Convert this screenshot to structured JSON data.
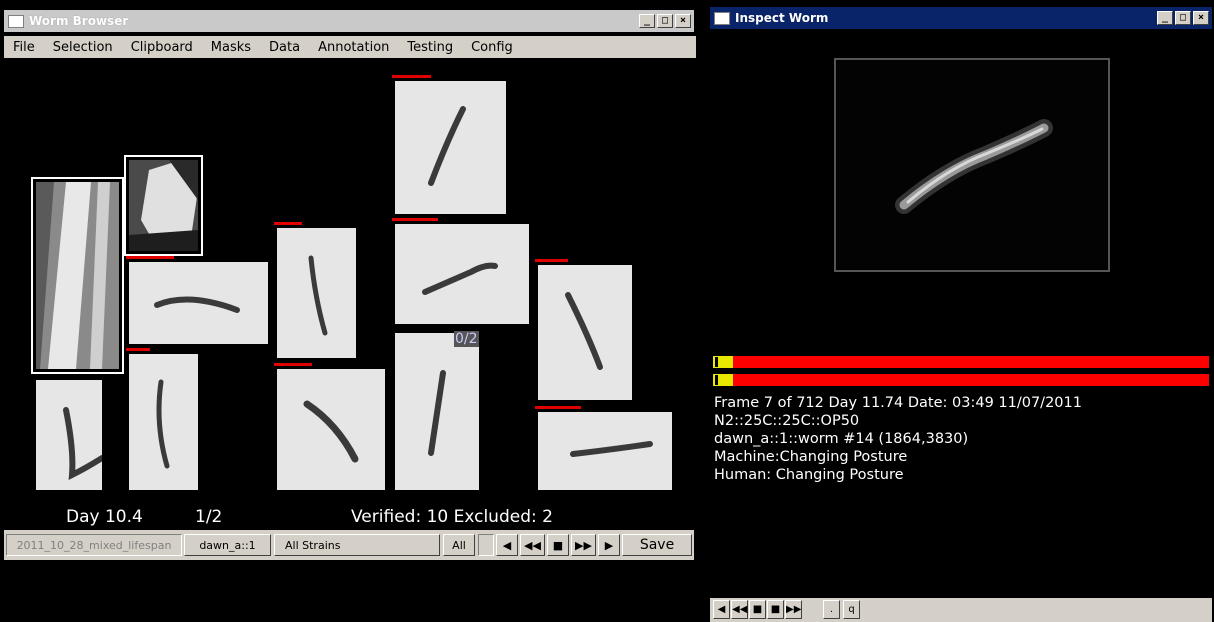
{
  "worm_browser": {
    "title": "Worm Browser",
    "menu": [
      "File",
      "Selection",
      "Clipboard",
      "Masks",
      "Data",
      "Annotation",
      "Testing",
      "Config"
    ],
    "thumb_badge": "0/2",
    "status": {
      "day": "Day 10.4",
      "page": "1/2",
      "summary": "Verified: 10 Excluded: 2"
    },
    "toolbar": {
      "experiment": "2011_10_28_mixed_lifespan",
      "plate": "dawn_a::1",
      "strain": "All Strains",
      "all": "All",
      "save": "Save"
    }
  },
  "inspect_worm": {
    "title": "Inspect Worm",
    "info": [
      "Frame 7 of 712 Day 11.74 Date: 03:49 11/07/2011",
      "N2::25C::25C::OP50",
      "dawn_a::1::worm #14 (1864,3830)",
      "Machine:Changing Posture",
      "Human: Changing Posture"
    ],
    "playback_progress": 0.04,
    "bottom": {
      "dot": ".",
      "q": "q"
    }
  },
  "colors": {
    "active_title": "#0a246a",
    "inactive_title": "#c9c9c9",
    "flag": "#e00000",
    "progress": "#ffff00"
  }
}
